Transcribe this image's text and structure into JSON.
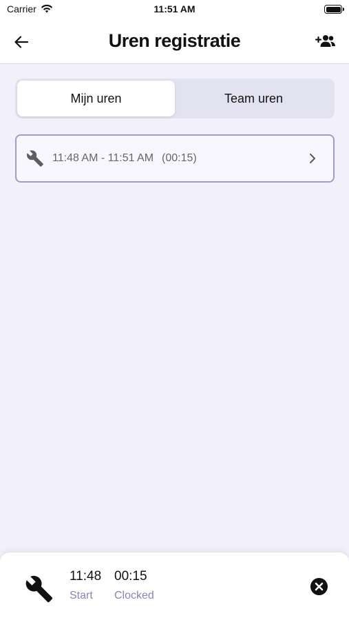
{
  "status_bar": {
    "carrier": "Carrier",
    "time": "11:51 AM"
  },
  "nav": {
    "title": "Uren registratie",
    "back_icon": "arrow-left-icon",
    "add_icon": "add-person-icon"
  },
  "tabs": [
    {
      "label": "Mijn uren",
      "active": true
    },
    {
      "label": "Team uren",
      "active": false
    }
  ],
  "entries": [
    {
      "icon": "wrench-icon",
      "time_range": "11:48 AM - 11:51 AM",
      "duration": "(00:15)"
    }
  ],
  "bottom_panel": {
    "icon": "wrench-icon",
    "start_value": "11:48",
    "start_label": "Start",
    "clocked_value": "00:15",
    "clocked_label": "Clocked",
    "close_icon": "close-circle-icon"
  },
  "colors": {
    "background": "#f1f0fb",
    "accent_border": "#a398cc",
    "label_purple": "#8b83b5"
  }
}
